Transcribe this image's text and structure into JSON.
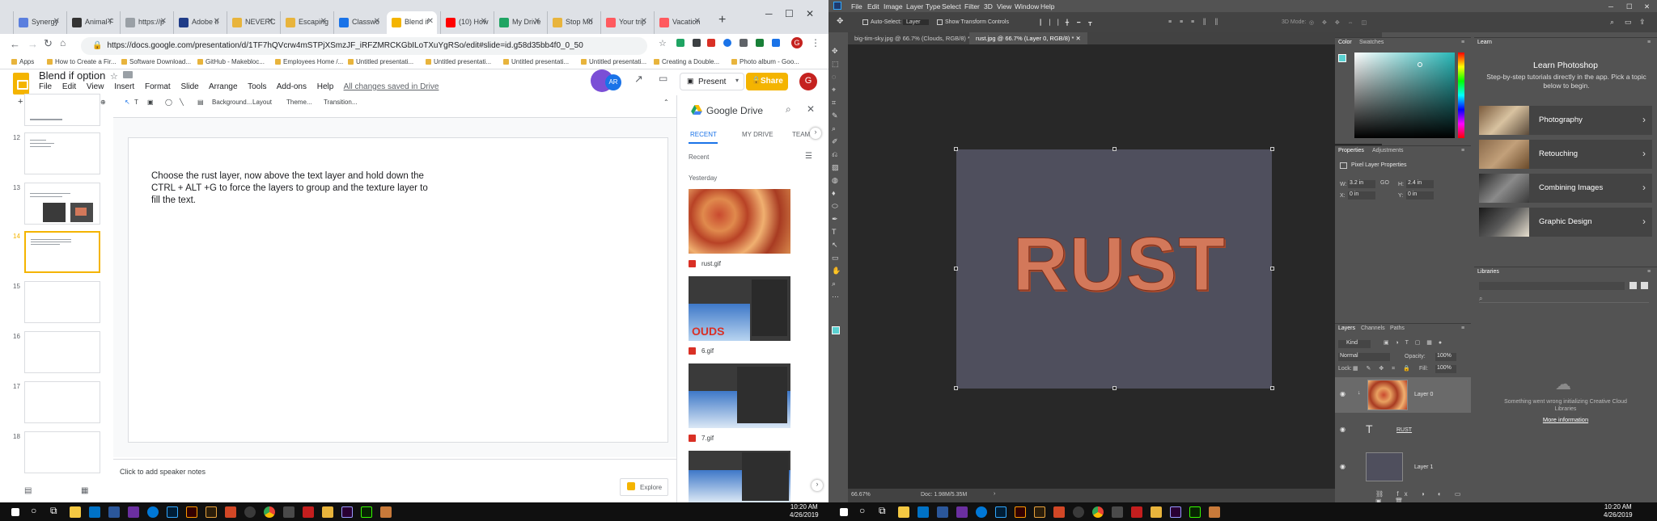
{
  "chrome": {
    "tabs": [
      {
        "label": "Synergy",
        "color": "#5b7fde"
      },
      {
        "label": "Animal F",
        "color": "#333333"
      },
      {
        "label": "https://p",
        "color": "#9aa0a6"
      },
      {
        "label": "Adobe Il",
        "color": "#1f3c88"
      },
      {
        "label": "NEVERC",
        "color": "#e8b43c"
      },
      {
        "label": "Escaping",
        "color": "#e8b43c"
      },
      {
        "label": "Classwo",
        "color": "#1a73e8"
      },
      {
        "label": "Blend if",
        "color": "#f4b400"
      },
      {
        "label": "(10) How",
        "color": "#ff0000"
      },
      {
        "label": "My Drive",
        "color": "#1fa463"
      },
      {
        "label": "Stop Mu",
        "color": "#e8b43c"
      },
      {
        "label": "Your trip",
        "color": "#ff5a5f"
      },
      {
        "label": "Vacation",
        "color": "#ff5a5f"
      }
    ],
    "active_tab_index": 7,
    "url": "https://docs.google.com/presentation/d/1TF7hQVcrw4mSTPjXSmzJF_iRFZMRCKGbILoTXuYgRSo/edit#slide=id.g58d35bb4f0_0_50",
    "bookmarks": [
      "Apps",
      "How to Create a Fir...",
      "Software Download...",
      "GitHub - Makebloc...",
      "Employees Home /...",
      "Untitled presentati...",
      "Untitled presentati...",
      "Untitled presentati...",
      "Untitled presentati...",
      "Creating a Double...",
      "Photo album - Goo..."
    ]
  },
  "slides": {
    "doc_title": "Blend if option",
    "menus": [
      "File",
      "Edit",
      "View",
      "Insert",
      "Format",
      "Slide",
      "Arrange",
      "Tools",
      "Add-ons",
      "Help"
    ],
    "saved_status": "All changes saved in Drive",
    "present_label": "Present",
    "share_label": "Share",
    "avatar_letter": "G",
    "toolbar": {
      "background": "Background...",
      "layout": "Layout",
      "theme": "Theme...",
      "transition": "Transition..."
    },
    "slide_numbers": [
      "12",
      "13",
      "14",
      "15",
      "16",
      "17",
      "18"
    ],
    "selected_slide": "14",
    "slide_text": "Choose the rust layer, now above the text layer and hold down the CTRL + ALT +G to force the layers to group and the texture layer to fill the text.",
    "speaker_notes_placeholder": "Click to add speaker notes",
    "explore_label": "Explore"
  },
  "drive": {
    "title": "Google Drive",
    "tabs": [
      "RECENT",
      "MY DRIVE",
      "TEAM"
    ],
    "recent_label": "Recent",
    "section_label": "Yesterday",
    "files": [
      "rust.gif",
      "6.gif",
      "7.gif"
    ]
  },
  "photoshop": {
    "menus": [
      "File",
      "Edit",
      "Image",
      "Layer",
      "Type",
      "Select",
      "Filter",
      "3D",
      "View",
      "Window",
      "Help"
    ],
    "options": {
      "auto_select": "Auto-Select:",
      "auto_select_value": "Layer",
      "transform_controls": "Show Transform Controls",
      "mode_3d": "3D Mode:"
    },
    "doc_tabs": [
      "big-tim-sky.jpg @ 66.7% (Clouds, RGB/8) *",
      "rust.jpg @ 66.7% (Layer 0, RGB/8) *"
    ],
    "canvas_text": "RUST",
    "zoom": "66.67%",
    "doc_size": "Doc: 1.98M/5.35M",
    "color_tabs": [
      "Color",
      "Swatches"
    ],
    "properties_tabs": [
      "Properties",
      "Adjustments"
    ],
    "pixel_layer_properties": "Pixel Layer Properties",
    "transform": {
      "w": "3.2 in",
      "h": "2.4 in",
      "x": "0 in",
      "y": "0 in"
    },
    "layers_tabs": [
      "Layers",
      "Channels",
      "Paths"
    ],
    "kind": "Kind",
    "blend_mode": "Normal",
    "opacity_label": "Opacity:",
    "opacity": "100%",
    "lock_label": "Lock:",
    "fill_label": "Fill:",
    "fill": "100%",
    "layers": [
      "Layer 0",
      "RUST",
      "Layer 1"
    ],
    "learn": {
      "tab": "Learn",
      "title": "Learn Photoshop",
      "subtitle": "Step-by-step tutorials directly in the app. Pick a topic below to begin.",
      "topics": [
        "Photography",
        "Retouching",
        "Combining Images",
        "Graphic Design"
      ]
    },
    "libraries": {
      "tab": "Libraries",
      "error": "Something went wrong initializing Creative Cloud Libraries",
      "more_info": "More information"
    }
  },
  "taskbar": {
    "left_time": "10:20 AM",
    "left_date": "4/26/2019",
    "right_time": "10:20 AM",
    "right_date": "4/26/2019"
  }
}
